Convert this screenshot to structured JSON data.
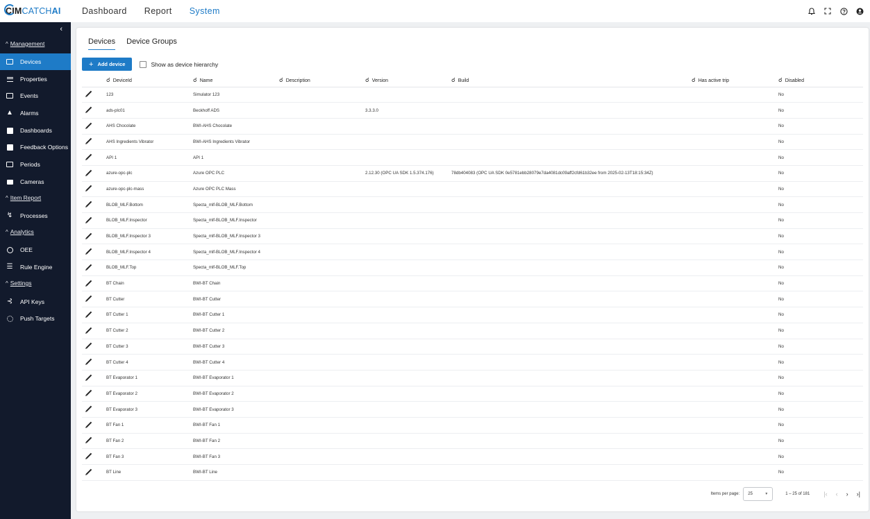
{
  "logo": {
    "cim": "CIM",
    "catch": "CATCH",
    "ai": "AI"
  },
  "topnav": [
    {
      "label": "Dashboard",
      "active": false
    },
    {
      "label": "Report",
      "active": false
    },
    {
      "label": "System",
      "active": true
    }
  ],
  "topicons": [
    "bell-icon",
    "fullscreen-icon",
    "help-icon",
    "account-icon"
  ],
  "sidebar": {
    "sections": [
      {
        "label": "Management"
      },
      {
        "label": "Item Report"
      },
      {
        "label": "Analytics"
      },
      {
        "label": "Settings"
      }
    ],
    "items": [
      {
        "label": "Devices",
        "icon": "devices-icon",
        "active": true
      },
      {
        "label": "Properties",
        "icon": "properties-icon"
      },
      {
        "label": "Events",
        "icon": "events-icon"
      },
      {
        "label": "Alarms",
        "icon": "alarm-bell-icon"
      },
      {
        "label": "Dashboards",
        "icon": "dashboards-icon"
      },
      {
        "label": "Feedback Options",
        "icon": "feedback-icon"
      },
      {
        "label": "Periods",
        "icon": "periods-icon"
      },
      {
        "label": "Cameras",
        "icon": "camera-icon"
      },
      {
        "label": "Processes",
        "icon": "processes-icon"
      },
      {
        "label": "OEE",
        "icon": "gauge-icon"
      },
      {
        "label": "Rule Engine",
        "icon": "rule-engine-icon"
      },
      {
        "label": "API Keys",
        "icon": "key-icon"
      },
      {
        "label": "Push Targets",
        "icon": "push-targets-icon"
      }
    ]
  },
  "tabs": [
    {
      "label": "Devices",
      "active": true
    },
    {
      "label": "Device Groups",
      "active": false
    }
  ],
  "toolbar": {
    "add_label": "Add device",
    "hierarchy_label": "Show as device hierarchy"
  },
  "table": {
    "columns": [
      "DeviceId",
      "Name",
      "Description",
      "Version",
      "Build",
      "Has active trip",
      "Disabled"
    ],
    "rows": [
      {
        "id": "123",
        "name": "Simulator 123",
        "description": "",
        "version": "",
        "build": "",
        "trip": "",
        "disabled": "No"
      },
      {
        "id": "ads-plc01",
        "name": "Beckhoff ADS",
        "description": "",
        "version": "3.3.3.0",
        "build": "",
        "trip": "",
        "disabled": "No"
      },
      {
        "id": "AHS Chocolate",
        "name": "BWI-AHS Chocolate",
        "description": "",
        "version": "",
        "build": "",
        "trip": "",
        "disabled": "No"
      },
      {
        "id": "AHS Ingredients Vibrator",
        "name": "BWI-AHS Ingredients Vibrator",
        "description": "",
        "version": "",
        "build": "",
        "trip": "",
        "disabled": "No"
      },
      {
        "id": "API 1",
        "name": "API 1",
        "description": "",
        "version": "",
        "build": "",
        "trip": "",
        "disabled": "No"
      },
      {
        "id": "azure-opc-plc",
        "name": "Azure OPC PLC",
        "description": "",
        "version": "2.12.30 (OPC UA SDK 1.5.374.176)",
        "build": "78db404083 (OPC UA SDK 0e5781ebb28079e7da4081dc09aff2cfd61b32ee from 2025-02-13T18:15:34Z)",
        "trip": "",
        "disabled": "No"
      },
      {
        "id": "azure-opc-plc-mass",
        "name": "Azure OPC PLC Mass",
        "description": "",
        "version": "",
        "build": "",
        "trip": "",
        "disabled": "No"
      },
      {
        "id": "BLOB_MLF.Bottom",
        "name": "Specta_mlf-BLOB_MLF.Bottom",
        "description": "",
        "version": "",
        "build": "",
        "trip": "",
        "disabled": "No"
      },
      {
        "id": "BLOB_MLF.Inspector",
        "name": "Specta_mlf-BLOB_MLF.Inspector",
        "description": "",
        "version": "",
        "build": "",
        "trip": "",
        "disabled": "No"
      },
      {
        "id": "BLOB_MLF.Inspector 3",
        "name": "Specta_mlf-BLOB_MLF.Inspector 3",
        "description": "",
        "version": "",
        "build": "",
        "trip": "",
        "disabled": "No"
      },
      {
        "id": "BLOB_MLF.Inspector 4",
        "name": "Specta_mlf-BLOB_MLF.Inspector 4",
        "description": "",
        "version": "",
        "build": "",
        "trip": "",
        "disabled": "No"
      },
      {
        "id": "BLOB_MLF.Top",
        "name": "Specta_mlf-BLOB_MLF.Top",
        "description": "",
        "version": "",
        "build": "",
        "trip": "",
        "disabled": "No"
      },
      {
        "id": "BT Chain",
        "name": "BWI-BT Chain",
        "description": "",
        "version": "",
        "build": "",
        "trip": "",
        "disabled": "No"
      },
      {
        "id": "BT Cutter",
        "name": "BWI-BT Cutter",
        "description": "",
        "version": "",
        "build": "",
        "trip": "",
        "disabled": "No"
      },
      {
        "id": "BT Cutter 1",
        "name": "BWI-BT Cutter 1",
        "description": "",
        "version": "",
        "build": "",
        "trip": "",
        "disabled": "No"
      },
      {
        "id": "BT Cutter 2",
        "name": "BWI-BT Cutter 2",
        "description": "",
        "version": "",
        "build": "",
        "trip": "",
        "disabled": "No"
      },
      {
        "id": "BT Cutter 3",
        "name": "BWI-BT Cutter 3",
        "description": "",
        "version": "",
        "build": "",
        "trip": "",
        "disabled": "No"
      },
      {
        "id": "BT Cutter 4",
        "name": "BWI-BT Cutter 4",
        "description": "",
        "version": "",
        "build": "",
        "trip": "",
        "disabled": "No"
      },
      {
        "id": "BT Evaporator 1",
        "name": "BWI-BT Evaporator 1",
        "description": "",
        "version": "",
        "build": "",
        "trip": "",
        "disabled": "No"
      },
      {
        "id": "BT Evaporator 2",
        "name": "BWI-BT Evaporator 2",
        "description": "",
        "version": "",
        "build": "",
        "trip": "",
        "disabled": "No"
      },
      {
        "id": "BT Evaporator 3",
        "name": "BWI-BT Evaporator 3",
        "description": "",
        "version": "",
        "build": "",
        "trip": "",
        "disabled": "No"
      },
      {
        "id": "BT Fan 1",
        "name": "BWI-BT Fan 1",
        "description": "",
        "version": "",
        "build": "",
        "trip": "",
        "disabled": "No"
      },
      {
        "id": "BT Fan 2",
        "name": "BWI-BT Fan 2",
        "description": "",
        "version": "",
        "build": "",
        "trip": "",
        "disabled": "No"
      },
      {
        "id": "BT Fan 3",
        "name": "BWI-BT Fan 3",
        "description": "",
        "version": "",
        "build": "",
        "trip": "",
        "disabled": "No"
      },
      {
        "id": "BT Line",
        "name": "BWI-BT Line",
        "description": "",
        "version": "",
        "build": "",
        "trip": "",
        "disabled": "No"
      }
    ]
  },
  "paginator": {
    "items_label": "Items per page:",
    "page_size": "25",
    "range": "1 – 25 of 181"
  },
  "colors": {
    "accent": "#1e7bc7",
    "sidebar": "#121a2c"
  }
}
